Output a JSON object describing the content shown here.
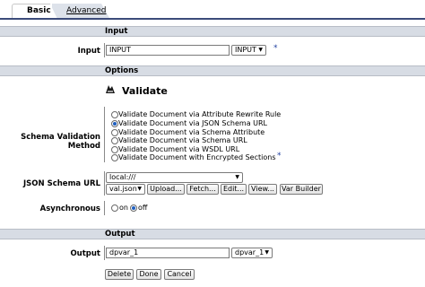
{
  "tabs": {
    "basic": "Basic",
    "advanced": "Advanced"
  },
  "sections": {
    "input": "Input",
    "options": "Options",
    "output": "Output"
  },
  "input_row": {
    "label": "Input",
    "value": "INPUT",
    "select_value": "INPUT",
    "required": "*"
  },
  "options": {
    "action_title": "Validate",
    "action_icon": "validate-icon",
    "schema_label": "Schema Validation Method",
    "methods": [
      "Validate Document via Attribute Rewrite Rule",
      "Validate Document via JSON Schema URL",
      "Validate Document via Schema Attribute",
      "Validate Document via Schema URL",
      "Validate Document via WSDL URL",
      "Validate Document with Encrypted Sections"
    ],
    "selected_method": 1,
    "methods_required": "*",
    "json_schema_label": "JSON Schema URL",
    "json_schema_location": "local:///",
    "json_schema_file": "val.json",
    "json_buttons": [
      "Upload...",
      "Fetch...",
      "Edit...",
      "View...",
      "Var Builder"
    ],
    "async_label": "Asynchronous",
    "async_on": "on",
    "async_off": "off",
    "async_value": "off"
  },
  "output_row": {
    "label": "Output",
    "value": "dpvar_1",
    "select_value": "dpvar_1"
  },
  "footer_buttons": [
    "Delete",
    "Done",
    "Cancel"
  ],
  "colors": {
    "header_bg": "#d7dce4",
    "rule": "#3c4b7a",
    "radio_selected": "#1f5fbf",
    "required_star": "#1f3f9f"
  }
}
